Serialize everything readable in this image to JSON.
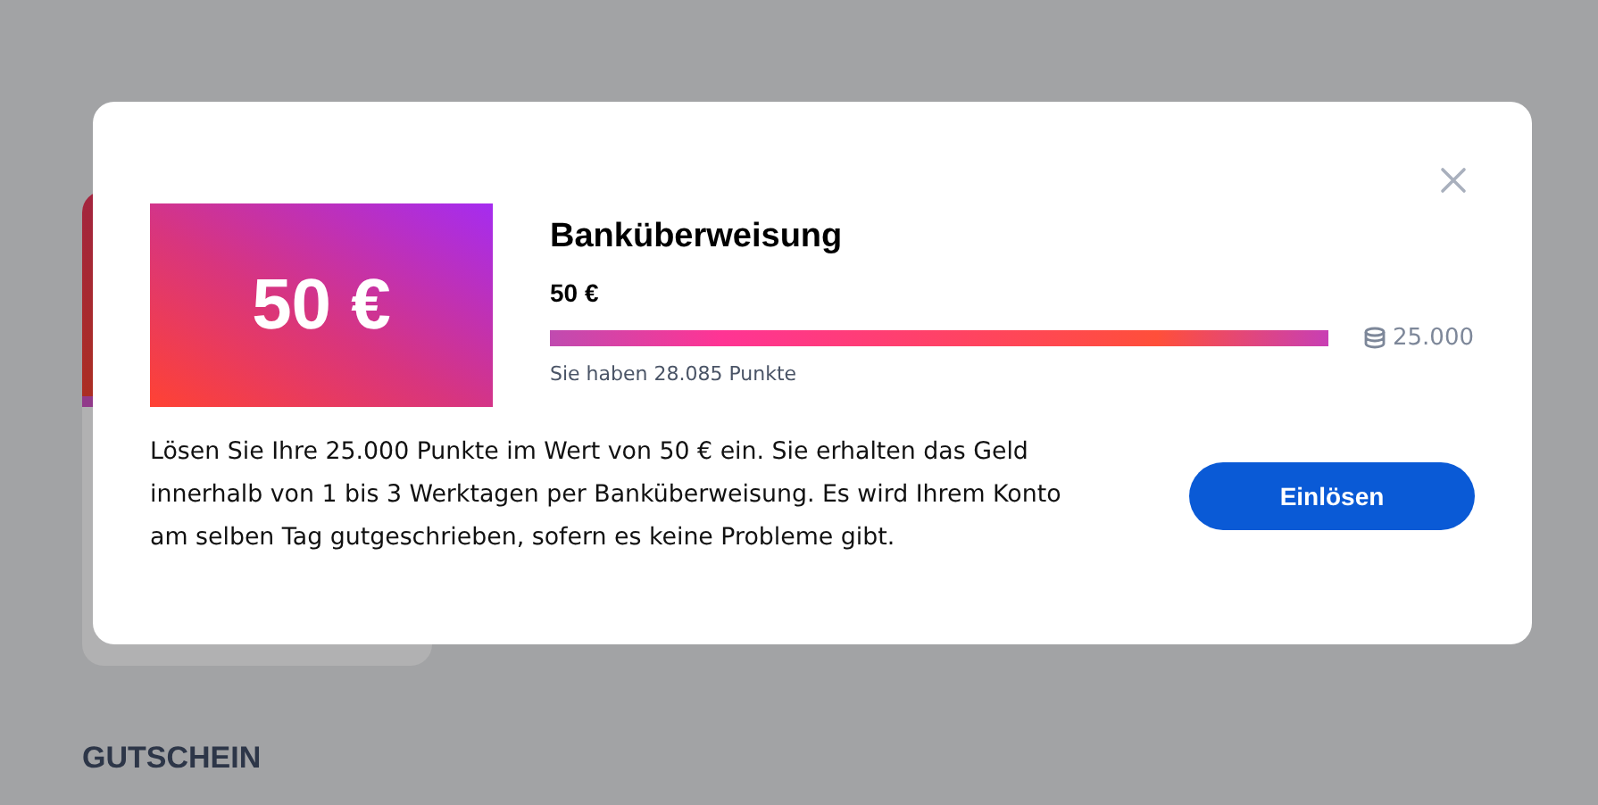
{
  "background": {
    "next_heading": "GUTSCHEIN"
  },
  "modal": {
    "card_value": "50 €",
    "title": "Banküberweisung",
    "amount": "50 €",
    "progress": {
      "level": 1,
      "cost": "25.000",
      "balance_note": "Sie haben 28.085 Punkte"
    },
    "description": "Lösen Sie Ihre 25.000 Punkte im Wert von 50 € ein. Sie erhalten das Geld innerhalb von 1 bis 3 Werktagen per Banküberweisung. Es wird Ihrem Konto am selben Tag gutgeschrieben, sofern es keine Probleme gibt.",
    "button": "Einlösen"
  }
}
